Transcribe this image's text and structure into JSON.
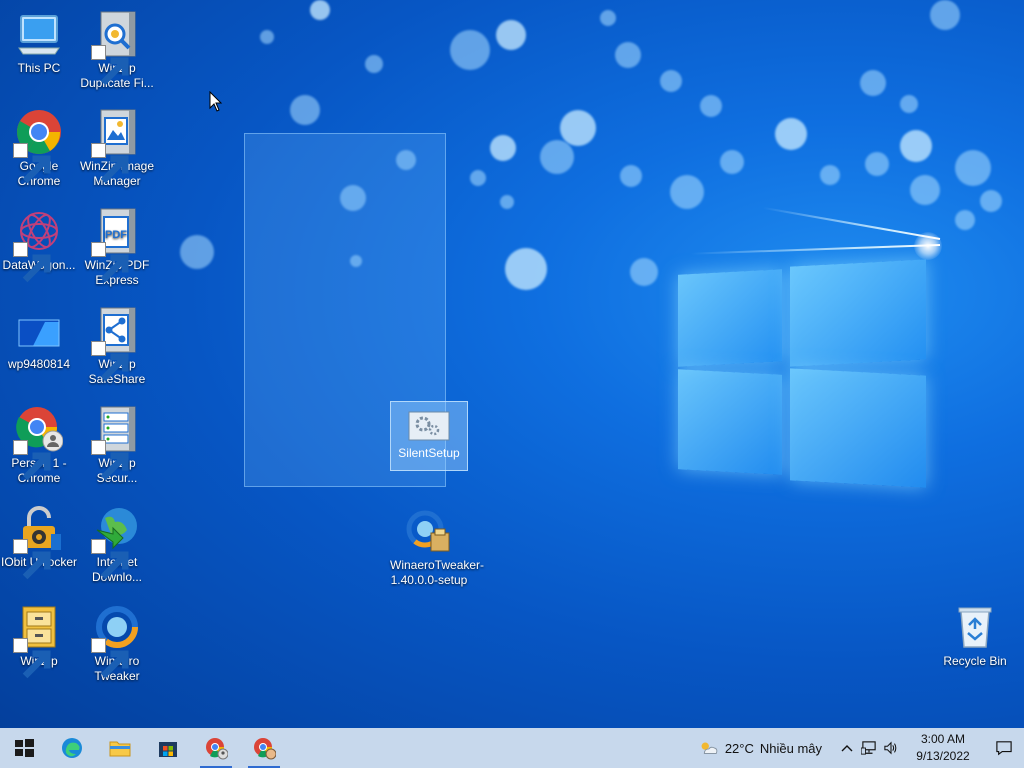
{
  "desktop": {
    "icons": {
      "this_pc": "This PC",
      "winzip_dup": "WinZip Duplicate Fi...",
      "google_chrome": "Google Chrome",
      "winzip_image": "WinZip Image Manager",
      "datawagon": "DataWagon...",
      "winzip_pdf": "WinZip PDF Express",
      "wp_image": "wp9480814",
      "winzip_safeshare": "WinZip SafeShare",
      "person_chrome": "Person 1 - Chrome",
      "winzip_secure": "WinZip Secur...",
      "iobit": "IObit Unlocker",
      "internet_download": "Internet Downlo...",
      "winzip": "WinZip",
      "winaero_tweaker": "Winaero Tweaker",
      "winaero_setup": "WinaeroTweaker-1.40.0.0-setup",
      "recycle_bin": "Recycle Bin"
    },
    "dragging": {
      "label": "SilentSetup"
    }
  },
  "taskbar": {
    "weather_temp": "22°C",
    "weather_text": "Nhiều mây",
    "time": "3:00 AM",
    "date": "9/13/2022"
  },
  "colors": {
    "taskbar_bg": "#c7d8ec",
    "accent": "#2f6bd1"
  }
}
